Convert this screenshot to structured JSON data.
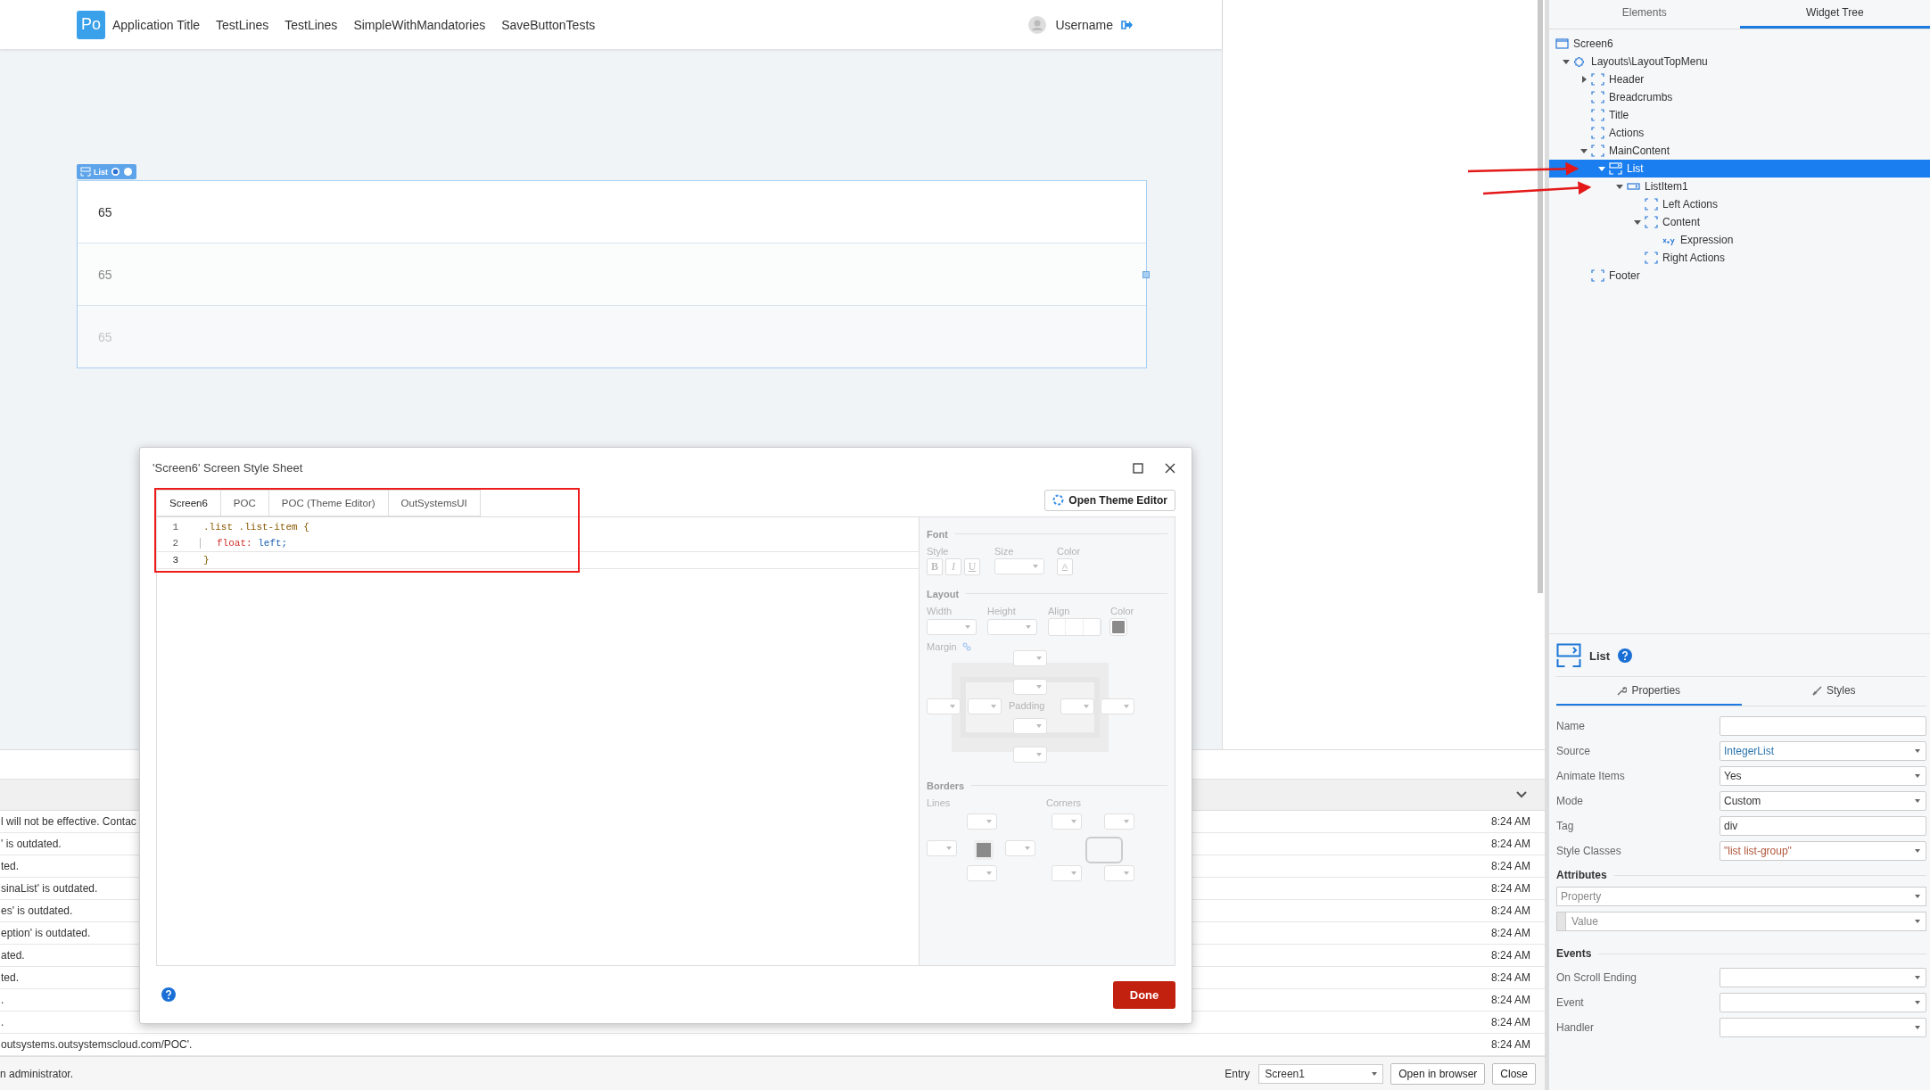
{
  "app_header": {
    "logo": "Po",
    "title": "Application Title",
    "menu": [
      "TestLines",
      "TestLines",
      "SimpleWithMandatories",
      "SaveButtonTests"
    ],
    "username": "Username"
  },
  "canvas": {
    "list_tag": "List",
    "rows": [
      "65",
      "65",
      "65"
    ]
  },
  "log": {
    "rows": [
      {
        "message": "l will not be effective. Contac",
        "time": "8:24 AM"
      },
      {
        "message": "' is outdated.",
        "time": "8:24 AM"
      },
      {
        "message": "ted.",
        "time": "8:24 AM"
      },
      {
        "message": "sinaList' is outdated.",
        "time": "8:24 AM"
      },
      {
        "message": "es' is outdated.",
        "time": "8:24 AM"
      },
      {
        "message": "eption' is outdated.",
        "time": "8:24 AM"
      },
      {
        "message": "ated.",
        "time": "8:24 AM"
      },
      {
        "message": "ted.",
        "time": "8:24 AM"
      },
      {
        "message": ".",
        "time": "8:24 AM"
      },
      {
        "message": ".",
        "time": "8:24 AM"
      },
      {
        "message": "outsystems.outsystemscloud.com/POC'.",
        "time": "8:24 AM"
      }
    ],
    "status": "n administrator.",
    "entry_label": "Entry",
    "entry_value": "Screen1",
    "buttons": [
      "Open in browser",
      "Close"
    ]
  },
  "dialog": {
    "title": "'Screen6' Screen Style Sheet",
    "tabs": [
      {
        "label": "Screen6",
        "selected": true
      },
      {
        "label": "POC",
        "selected": false
      },
      {
        "label": "POC (Theme Editor)",
        "selected": false
      },
      {
        "label": "OutSystemsUI",
        "selected": false
      }
    ],
    "theme_button": "Open Theme Editor",
    "code": [
      {
        "number": "1",
        "current": false,
        "segments": [
          {
            "text": ".list .list-item {",
            "kind": "selector"
          }
        ]
      },
      {
        "number": "2",
        "current": false,
        "segments": [
          {
            "text": "float:",
            "kind": "property"
          },
          {
            "text": "left;",
            "kind": "value"
          }
        ]
      },
      {
        "number": "3",
        "current": true,
        "segments": [
          {
            "text": "}",
            "kind": "selector"
          }
        ]
      }
    ],
    "style_panel": {
      "disabled": true,
      "font_title": "Font",
      "font_labels": [
        "Style",
        "Size",
        "Color"
      ],
      "format_buttons": [
        "B",
        "I",
        "U"
      ],
      "color_button": "A",
      "layout_title": "Layout",
      "layout_labels": [
        "Width",
        "Height",
        "Align",
        "Color"
      ],
      "margin": "Margin",
      "padding": "Padding",
      "borders_title": "Borders",
      "lines": "Lines",
      "corners": "Corners"
    },
    "done": "Done"
  },
  "sidebar": {
    "tabs": [
      {
        "label": "Elements",
        "selected": false
      },
      {
        "label": "Widget Tree",
        "selected": true
      }
    ],
    "tree": [
      {
        "label": "Screen6",
        "kind": "screen",
        "selected": false,
        "children": [
          {
            "label": "Layouts\\LayoutTopMenu",
            "kind": "layout",
            "expanded": true,
            "selected": false,
            "children": [
              {
                "label": "Header",
                "kind": "container",
                "expanded": false,
                "selected": false
              },
              {
                "label": "Breadcrumbs",
                "kind": "container",
                "selected": false
              },
              {
                "label": "Title",
                "kind": "container",
                "selected": false
              },
              {
                "label": "Actions",
                "kind": "container",
                "selected": false
              },
              {
                "label": "MainContent",
                "kind": "container",
                "expanded": true,
                "selected": false,
                "children": [
                  {
                    "label": "List",
                    "kind": "list",
                    "expanded": true,
                    "selected": true,
                    "children": [
                      {
                        "label": "ListItem1",
                        "kind": "list-item",
                        "expanded": true,
                        "selected": false,
                        "children": [
                          {
                            "label": "Left Actions",
                            "kind": "container",
                            "selected": false
                          },
                          {
                            "label": "Content",
                            "kind": "container",
                            "expanded": true,
                            "selected": false,
                            "children": [
                              {
                                "label": "Expression",
                                "kind": "expression",
                                "selected": false
                              }
                            ]
                          },
                          {
                            "label": "Right Actions",
                            "kind": "container",
                            "selected": false
                          }
                        ]
                      }
                    ]
                  }
                ]
              },
              {
                "label": "Footer",
                "kind": "container",
                "selected": false
              }
            ]
          }
        ]
      }
    ],
    "properties": {
      "title": "List",
      "tabs": [
        {
          "label": "Properties",
          "selected": true
        },
        {
          "label": "Styles",
          "selected": false
        }
      ],
      "fields": [
        {
          "label": "Name",
          "kind": "text"
        },
        {
          "label": "Source",
          "kind": "select",
          "value": "IntegerList",
          "color": "#2a74ad"
        },
        {
          "label": "Animate Items",
          "kind": "select",
          "value": "Yes",
          "color": "#333333"
        },
        {
          "label": "Mode",
          "kind": "select",
          "value": "Custom",
          "color": "#333333"
        },
        {
          "label": "Tag",
          "kind": "text",
          "value": "div",
          "color": "#333333"
        },
        {
          "label": "Style Classes",
          "kind": "select",
          "value": "\"list list-group\"",
          "color": "#b0553a"
        }
      ],
      "attributes_title": "Attributes",
      "attribute_property": "Property",
      "attribute_value": "Value",
      "events_title": "Events",
      "events": [
        {
          "label": "On Scroll Ending"
        },
        {
          "label": "Event"
        },
        {
          "label": "Handler"
        }
      ]
    }
  }
}
